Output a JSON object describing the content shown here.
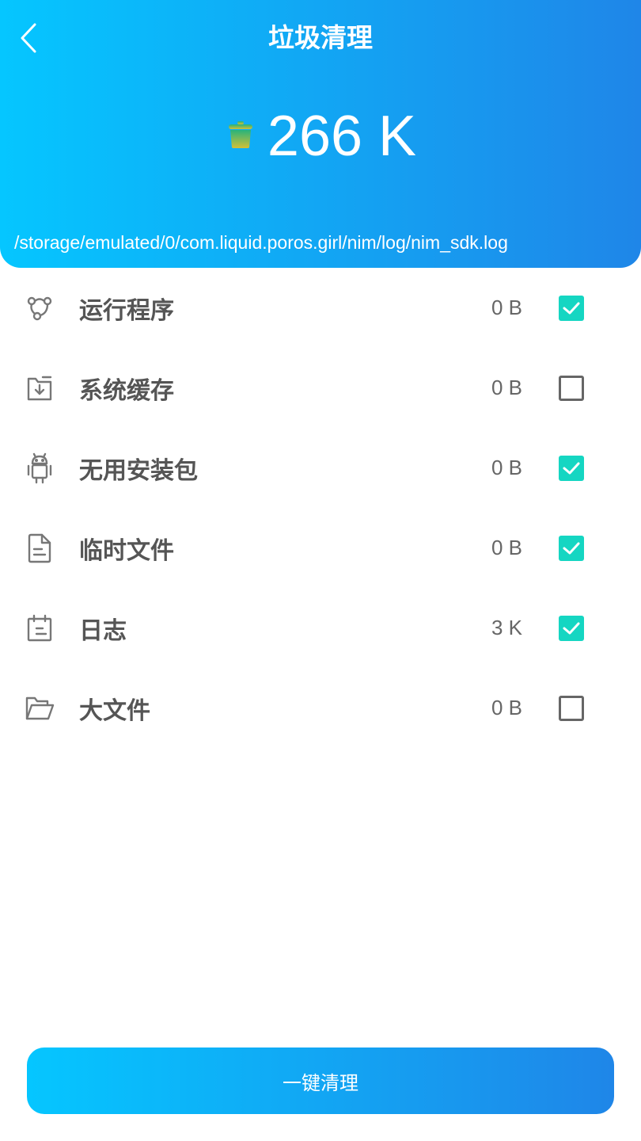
{
  "header": {
    "title": "垃圾清理",
    "total_size": "266 K",
    "scan_path": "/storage/emulated/0/com.liquid.poros.girl/nim/log/nim_sdk.log",
    "back_icon": "back-chevron-icon",
    "trash_icon": "trash-can-icon",
    "gradient_start": "#05c6ff",
    "gradient_end": "#1f86e8"
  },
  "items": [
    {
      "label": "运行程序",
      "size": "0 B",
      "checked": true,
      "icon": "running-apps-icon"
    },
    {
      "label": "系统缓存",
      "size": "0 B",
      "checked": false,
      "icon": "system-cache-icon"
    },
    {
      "label": "无用安装包",
      "size": "0 B",
      "checked": true,
      "icon": "android-icon"
    },
    {
      "label": "临时文件",
      "size": "0 B",
      "checked": true,
      "icon": "document-icon"
    },
    {
      "label": "日志",
      "size": "3 K",
      "checked": true,
      "icon": "calendar-log-icon"
    },
    {
      "label": "大文件",
      "size": "0 B",
      "checked": false,
      "icon": "folder-icon"
    }
  ],
  "clean_button": {
    "label": "一键清理"
  },
  "colors": {
    "check_accent": "#15d6c2",
    "label_text": "#555555"
  }
}
